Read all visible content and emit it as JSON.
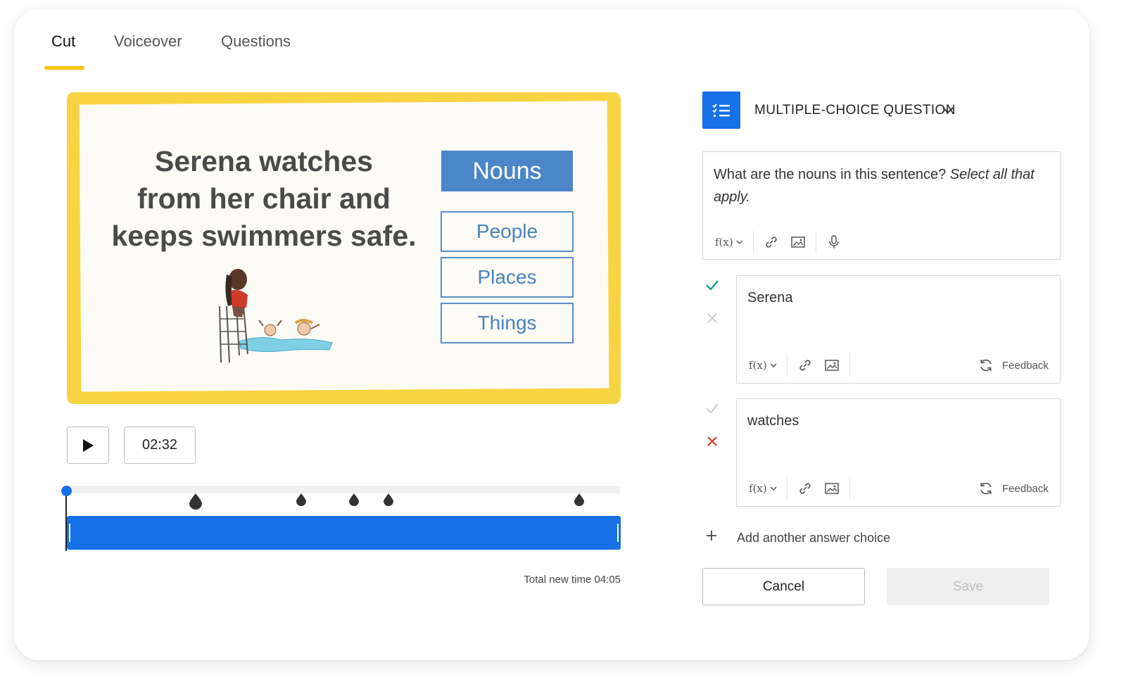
{
  "tabs": [
    {
      "label": "Cut",
      "active": true
    },
    {
      "label": "Voiceover",
      "active": false
    },
    {
      "label": "Questions",
      "active": false
    }
  ],
  "slide": {
    "sentence_lines": [
      "Serena watches",
      "from her chair and",
      "keeps swimmers safe."
    ],
    "category_header": "Nouns",
    "categories": [
      "People",
      "Places",
      "Things"
    ],
    "frame_color": "#f8d443",
    "header_color": "#4a86c8"
  },
  "player": {
    "play_icon": "play-icon",
    "current_time": "02:32",
    "total_new_time": "Total new time 04:05",
    "accent_color": "#1670e6"
  },
  "question_panel": {
    "type_icon": "checklist-icon",
    "type_label": "MULTIPLE-CHOICE QUESTION",
    "question_text": "What are the nouns in this sentence?",
    "question_hint": "Select all that apply.",
    "toolbar": {
      "formula_label": "f(x)",
      "icons": [
        "link-icon",
        "image-icon",
        "microphone-icon"
      ]
    },
    "answers": [
      {
        "text": "Serena",
        "correct": true,
        "feedback_label": "Feedback"
      },
      {
        "text": "watches",
        "correct": false,
        "feedback_label": "Feedback"
      }
    ],
    "add_choice_label": "Add another answer choice",
    "cancel_label": "Cancel",
    "save_label": "Save",
    "correct_color": "#19a38c",
    "incorrect_color": "#e0392b"
  }
}
